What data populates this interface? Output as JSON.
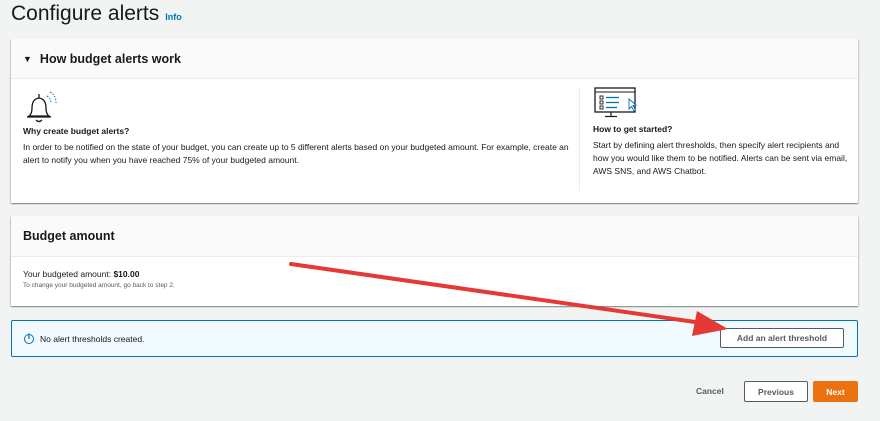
{
  "page": {
    "title": "Configure alerts",
    "info_link": "Info"
  },
  "how_section": {
    "title": "How budget alerts work",
    "why": {
      "icon": "bell-icon",
      "heading": "Why create budget alerts?",
      "text": "In order to be notified on the state of your budget, you can create up to 5 different alerts based on your budgeted amount. For example, create an alert to notify you when you have reached 75% of your budgeted amount."
    },
    "how": {
      "icon": "monitor-checklist-icon",
      "heading": "How to get started?",
      "text": "Start by defining alert thresholds, then specify alert recipients and how you would like them to be notified. Alerts can be sent via email, AWS SNS, and AWS Chatbot."
    }
  },
  "budget_amount": {
    "title": "Budget amount",
    "label": "Your budgeted amount:",
    "value": "$10.00",
    "hint": "To change your budgeted amount, go back to step 2."
  },
  "alerts": {
    "empty_text": "No alert thresholds created.",
    "add_button": "Add an alert threshold"
  },
  "footer": {
    "cancel": "Cancel",
    "previous": "Previous",
    "next": "Next"
  },
  "colors": {
    "accent": "#0073bb",
    "primary_button": "#ec7211",
    "annotation_arrow": "#e53935"
  }
}
